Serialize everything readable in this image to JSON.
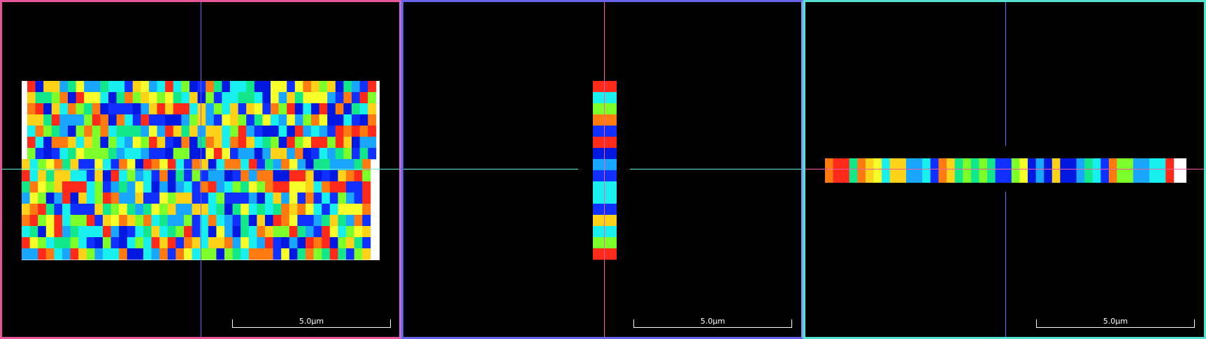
{
  "panels": [
    {
      "id": "xy",
      "scale_label": "5.0µm"
    },
    {
      "id": "xz",
      "scale_label": "5.0µm"
    },
    {
      "id": "yz",
      "scale_label": "5.0µm"
    }
  ],
  "colors": {
    "xy_border": "#e8569a",
    "xz_border": "#6a63e8",
    "yz_border": "#55e0cf",
    "crosshair_blue": "#6b66ff",
    "crosshair_pink": "#ff5ca8",
    "crosshair_cyan": "#66f0e0"
  },
  "tile_palette": [
    "#ff2a1a",
    "#ff7a10",
    "#ffd21a",
    "#f6ff2a",
    "#7dff2a",
    "#12e88a",
    "#18f0f0",
    "#18a6ff",
    "#1030ff",
    "#0018e0"
  ]
}
